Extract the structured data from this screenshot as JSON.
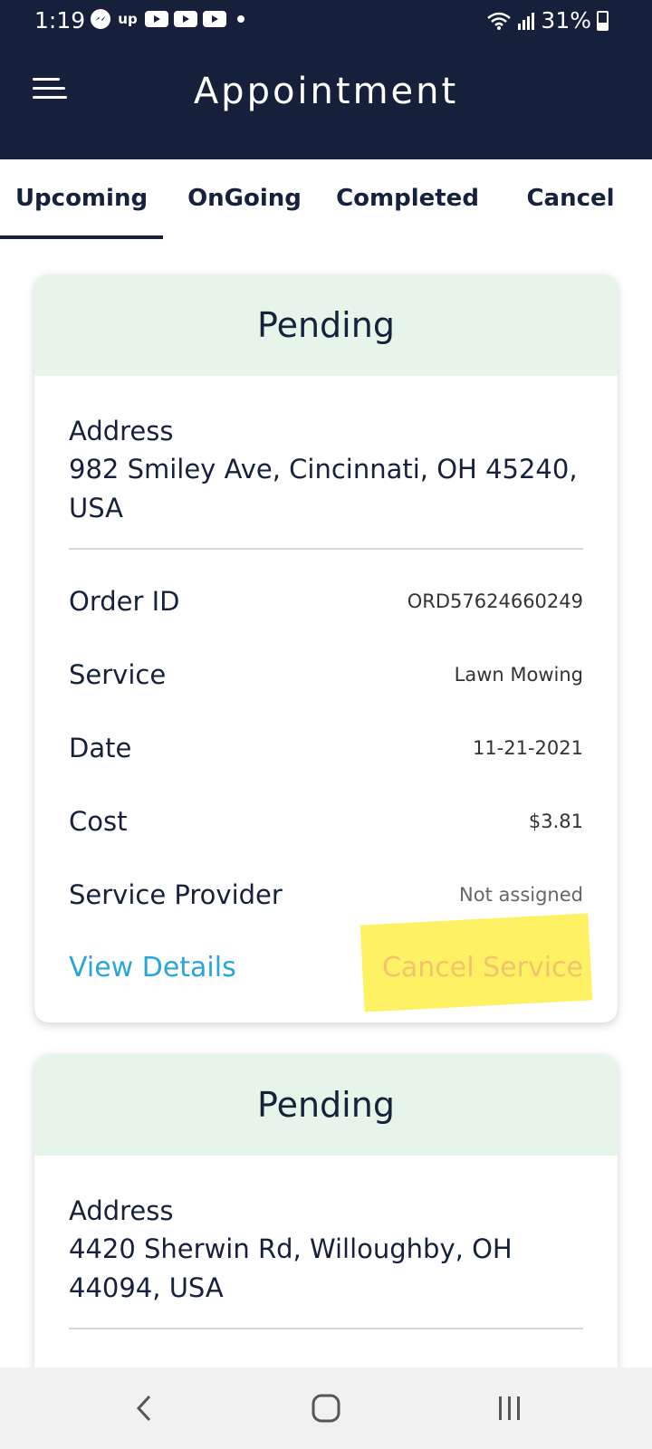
{
  "status_bar": {
    "time": "1:19",
    "left_icons": [
      "messenger-icon",
      "ux-icon",
      "youtube-icon",
      "youtube-icon",
      "youtube-icon",
      "dot-icon"
    ],
    "battery": "31%"
  },
  "header": {
    "title": "Appointment"
  },
  "tabs": [
    {
      "label": "Upcoming",
      "active": true
    },
    {
      "label": "OnGoing",
      "active": false
    },
    {
      "label": "Completed",
      "active": false
    },
    {
      "label": "Cancel",
      "active": false
    }
  ],
  "cards": [
    {
      "status": "Pending",
      "address_label": "Address",
      "address": "982 Smiley Ave, Cincinnati, OH 45240, USA",
      "rows": [
        {
          "label": "Order ID",
          "value": "ORD57624660249"
        },
        {
          "label": "Service",
          "value": "Lawn Mowing"
        },
        {
          "label": "Date",
          "value": "11-21-2021"
        },
        {
          "label": "Cost",
          "value": "$3.81"
        },
        {
          "label": "Service Provider",
          "value": "Not assigned"
        }
      ],
      "view_details": "View Details",
      "cancel_service": "Cancel Service"
    },
    {
      "status": "Pending",
      "address_label": "Address",
      "address": "4420 Sherwin Rd, Willoughby, OH 44094, USA"
    }
  ],
  "colors": {
    "header_bg": "#17203a",
    "status_band": "#e6f4ea",
    "link": "#2aa5d8",
    "cancel_text": "#f2c36a",
    "highlight": "#ffec28"
  }
}
